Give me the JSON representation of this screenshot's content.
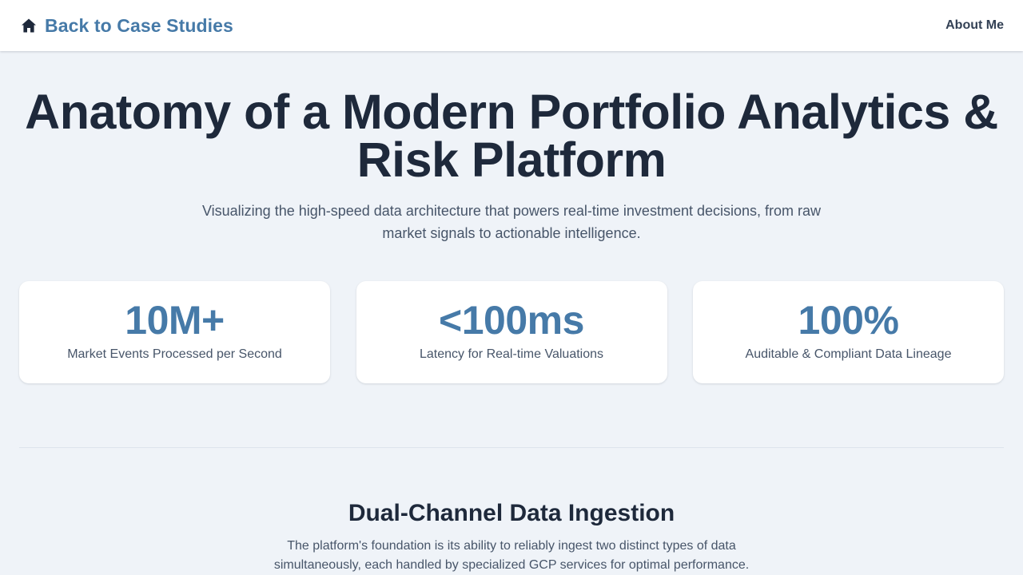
{
  "nav": {
    "back_label": "Back to Case Studies",
    "back_icon": "home-icon",
    "about_label": "About Me"
  },
  "hero": {
    "title": "Anatomy of a Modern Portfolio Analytics & Risk Platform",
    "subtitle": "Visualizing the high-speed data architecture that powers real-time investment decisions, from raw market signals to actionable intelligence."
  },
  "stats": [
    {
      "value": "10M+",
      "label": "Market Events Processed per Second"
    },
    {
      "value": "<100ms",
      "label": "Latency for Real-time Valuations"
    },
    {
      "value": "100%",
      "label": "Auditable & Compliant Data Lineage"
    }
  ],
  "section": {
    "title": "Dual-Channel Data Ingestion",
    "text": "The platform's foundation is its ability to reliably ingest two distinct types of data simultaneously, each handled by specialized GCP services for optimal performance."
  },
  "colors": {
    "accent": "#467aa8",
    "heading": "#1e293b",
    "body_text": "#475569",
    "background": "#eff3f8",
    "card": "#ffffff"
  }
}
